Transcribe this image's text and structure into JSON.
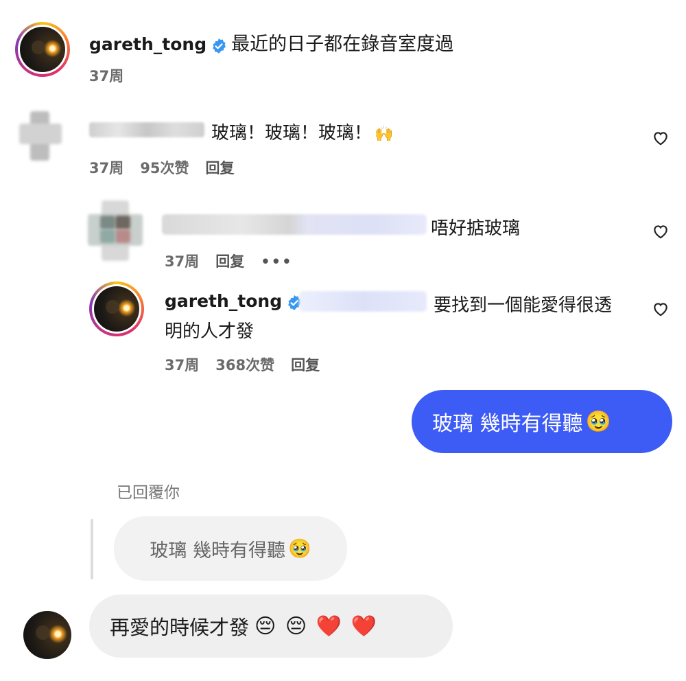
{
  "post": {
    "username": "gareth_tong",
    "caption": "最近的日子都在錄音室度過",
    "time": "37周"
  },
  "comments": [
    {
      "text": "玻璃！玻璃！玻璃！",
      "emoji": "🙌",
      "time": "37周",
      "likes": "95次赞",
      "reply_label": "回复"
    },
    {
      "text": "唔好掂玻璃",
      "time": "37周",
      "reply_label": "回复",
      "more": "•••"
    },
    {
      "username": "gareth_tong",
      "text_line1": "要找到一個能愛得很透",
      "text_line2": "明的人才發",
      "time": "37周",
      "likes": "368次赞",
      "reply_label": "回复"
    }
  ],
  "dm": {
    "sent_message": "玻璃 幾時有得聽",
    "sent_emoji": "🥹",
    "replied_label": "已回覆你",
    "quoted_message": "玻璃 幾時有得聽",
    "quoted_emoji": "🥹",
    "reply_message": "再愛的時候才發",
    "reply_emojis": "😔 😔 ❤️ ❤️"
  },
  "colors": {
    "accent_blue": "#3d5bf5",
    "verified_blue": "#3897f0",
    "meta_gray": "#6b6b6b"
  }
}
